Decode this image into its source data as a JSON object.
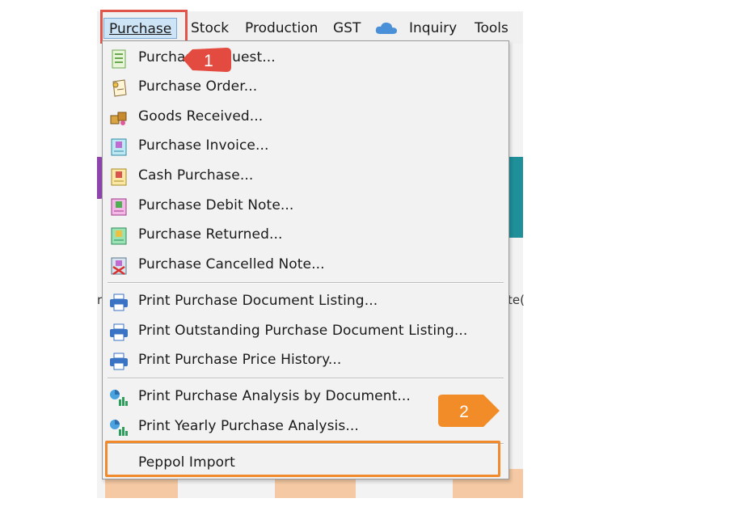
{
  "menubar": {
    "items": [
      {
        "label": "Purchase",
        "active": true
      },
      {
        "label": "Stock"
      },
      {
        "label": "Production"
      },
      {
        "label": "GST"
      },
      {
        "label": "Inquiry"
      },
      {
        "label": "Tools"
      }
    ],
    "cloud_icon": "cloud-icon"
  },
  "dropdown": {
    "items": [
      {
        "label": "Purchase Request...",
        "icon": "purchase-request-icon"
      },
      {
        "label": "Purchase Order...",
        "icon": "purchase-order-icon"
      },
      {
        "label": "Goods Received...",
        "icon": "goods-received-icon"
      },
      {
        "label": "Purchase Invoice...",
        "icon": "purchase-invoice-icon"
      },
      {
        "label": "Cash Purchase...",
        "icon": "cash-purchase-icon"
      },
      {
        "label": "Purchase Debit Note...",
        "icon": "purchase-debit-note-icon"
      },
      {
        "label": "Purchase Returned...",
        "icon": "purchase-returned-icon"
      },
      {
        "label": "Purchase Cancelled Note...",
        "icon": "purchase-cancelled-note-icon"
      },
      {
        "label": "Print Purchase Document Listing...",
        "icon": "printer-icon"
      },
      {
        "label": "Print Outstanding Purchase Document Listing...",
        "icon": "printer-icon"
      },
      {
        "label": "Print Purchase Price History...",
        "icon": "printer-icon"
      },
      {
        "label": "Print Purchase Analysis by Document...",
        "icon": "analysis-chart-icon"
      },
      {
        "label": "Print Yearly Purchase Analysis...",
        "icon": "analysis-chart-icon"
      },
      {
        "label": "Peppol Import"
      }
    ]
  },
  "callouts": {
    "step1": "1",
    "step2": "2"
  },
  "background": {
    "stray_left": "r",
    "stray_right": "te("
  },
  "colors": {
    "red_highlight": "#e0544a",
    "orange_highlight": "#f08a2c",
    "active_menu_bg": "#cde4f7"
  }
}
